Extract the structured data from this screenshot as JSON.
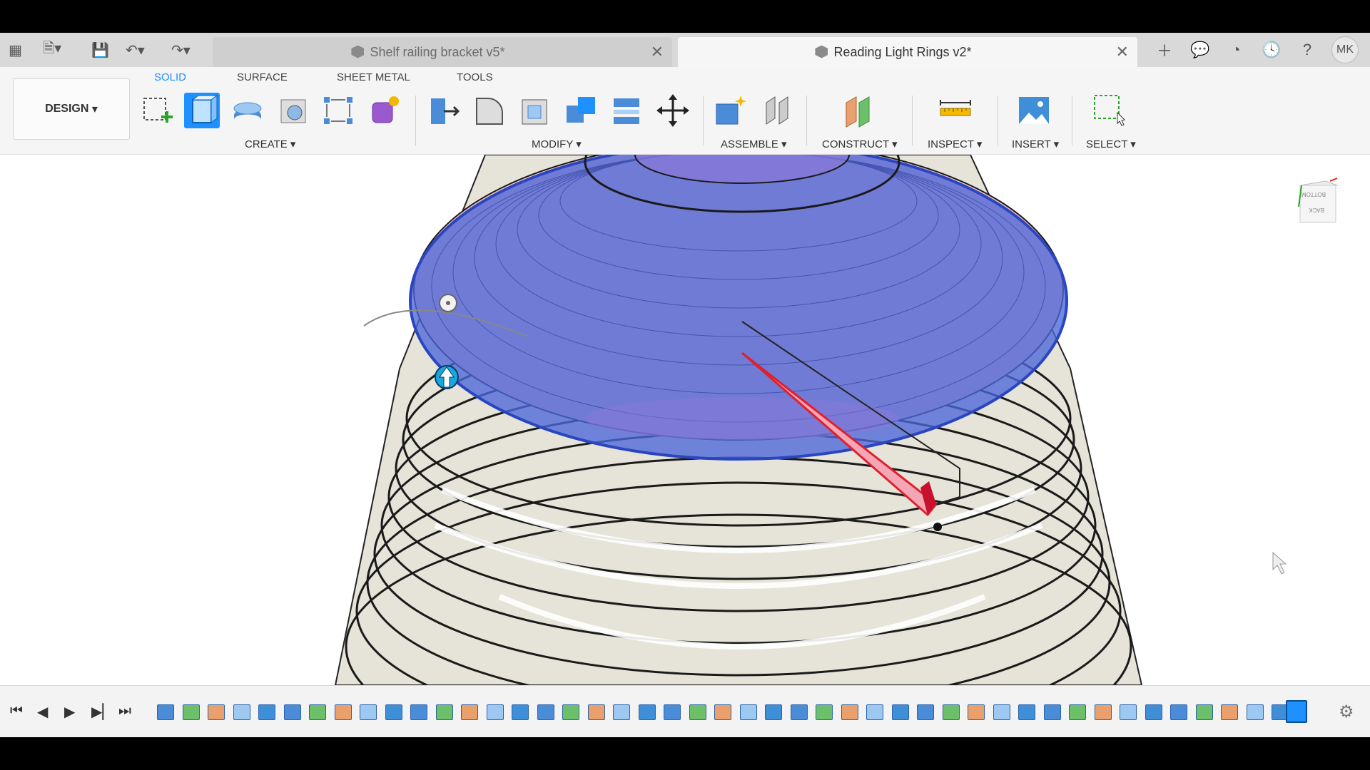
{
  "tabs": [
    {
      "label": "Shelf railing bracket v5*",
      "active": false
    },
    {
      "label": "Reading Light Rings v2*",
      "active": true
    }
  ],
  "user_initials": "MK",
  "workspace": {
    "label": "DESIGN"
  },
  "workspace_tabs": [
    "SOLID",
    "SURFACE",
    "SHEET METAL",
    "TOOLS"
  ],
  "groups": [
    "CREATE",
    "MODIFY",
    "ASSEMBLE",
    "CONSTRUCT",
    "INSPECT",
    "INSERT",
    "SELECT"
  ],
  "colors": {
    "accent": "#1e90ff",
    "selection_blue": "#3b55d6",
    "pink": "#e06b7a",
    "body": "#d7d5c8"
  },
  "viewcube": {
    "faces": [
      "BOTTOM",
      "BACK"
    ]
  },
  "timeline_count": 45
}
